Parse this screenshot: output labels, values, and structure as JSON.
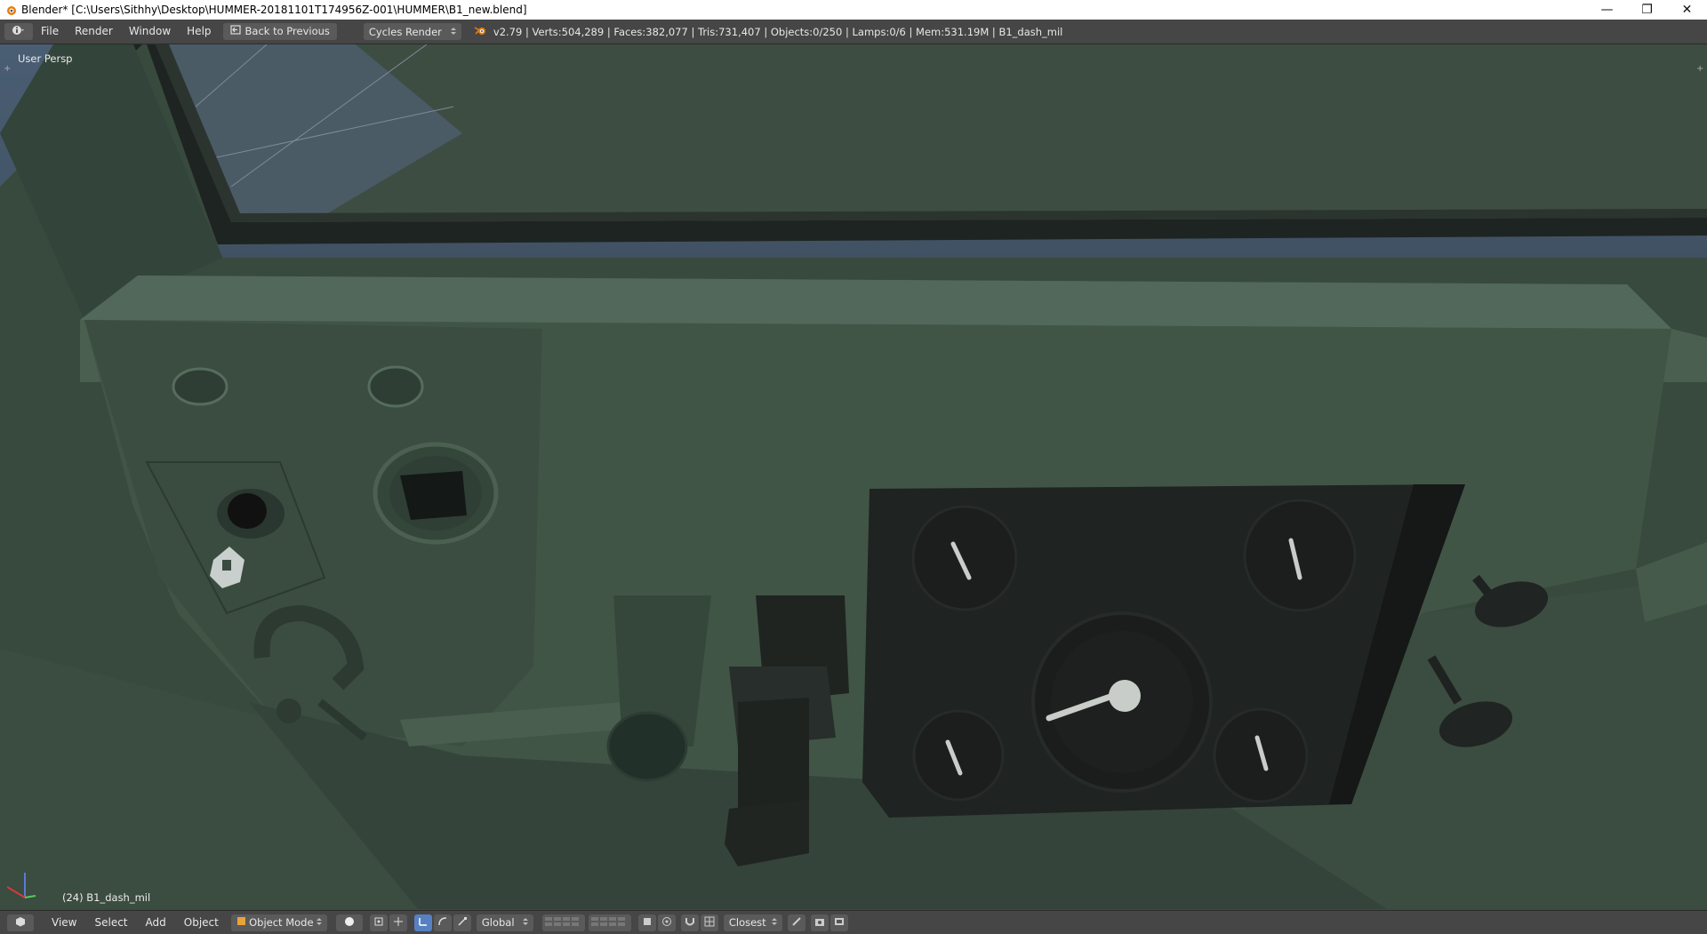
{
  "window": {
    "title": "Blender* [C:\\Users\\Sithhy\\Desktop\\HUMMER-20181101T174956Z-001\\HUMMER\\B1_new.blend]",
    "controls": [
      "—",
      "❐",
      "✕"
    ]
  },
  "info_header": {
    "menus": [
      "File",
      "Render",
      "Window",
      "Help"
    ],
    "back_label": "Back to Previous",
    "render_engine": "Cycles Render",
    "stats": "v2.79 | Verts:504,289 | Faces:382,077 | Tris:731,407 | Objects:0/250 | Lamps:0/6 | Mem:531.19M | B1_dash_mil"
  },
  "viewport": {
    "view_name": "User Persp",
    "active_object": "(24) B1_dash_mil",
    "colors": {
      "panel": "#3f5244",
      "dash_plate": "#1e2220",
      "needle": "#c8cdc9"
    }
  },
  "view3d_header": {
    "menus": [
      "View",
      "Select",
      "Add",
      "Object"
    ],
    "mode": "Object Mode",
    "orientation": "Global",
    "snap_target": "Closest"
  }
}
